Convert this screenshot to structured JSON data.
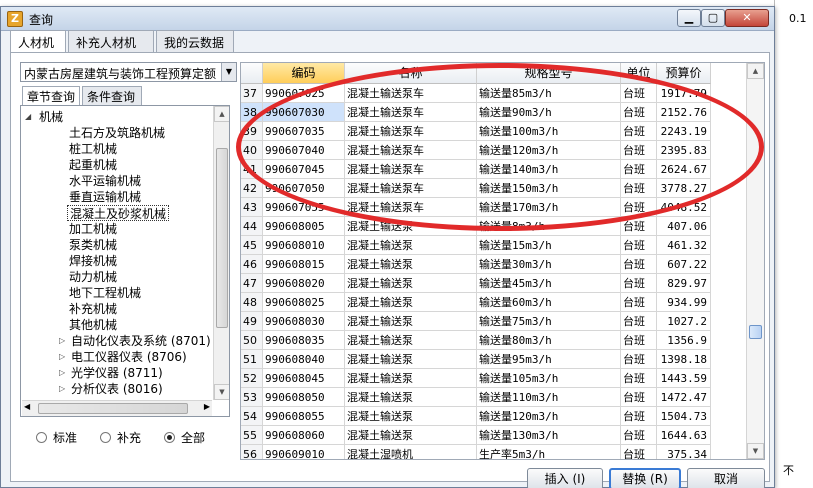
{
  "window": {
    "title": "查询",
    "app_icon": "app-logo-icon"
  },
  "background": {
    "right_value": "0.1",
    "bottom_right": "不"
  },
  "tabs": [
    {
      "label": "人材机",
      "active": true
    },
    {
      "label": "补充人材机",
      "active": false
    },
    {
      "label": "我的云数据",
      "active": false
    }
  ],
  "library_combo": {
    "value": "内蒙古房屋建筑与装饰工程预算定额"
  },
  "subtabs": [
    {
      "label": "章节查询",
      "active": true
    },
    {
      "label": "条件查询",
      "active": false
    }
  ],
  "tree": {
    "root": "机械",
    "children": [
      "土石方及筑路机械",
      "桩工机械",
      "起重机械",
      "水平运输机械",
      "垂直运输机械",
      "混凝土及砂浆机械",
      "加工机械",
      "泵类机械",
      "焊接机械",
      "动力机械",
      "地下工程机械",
      "补充机械",
      "其他机械"
    ],
    "selected": "混凝土及砂浆机械",
    "collapsed": [
      "自动化仪表及系统 (8701)",
      "电工仪器仪表 (8706)",
      "光学仪器 (8711)",
      "分析仪表 (8016)"
    ]
  },
  "filter": [
    {
      "label": "标准",
      "checked": false
    },
    {
      "label": "补充",
      "checked": false
    },
    {
      "label": "全部",
      "checked": true
    }
  ],
  "grid": {
    "columns": [
      {
        "key": "idx",
        "label": ""
      },
      {
        "key": "code",
        "label": "编码"
      },
      {
        "key": "name",
        "label": "名称"
      },
      {
        "key": "spec",
        "label": "规格型号"
      },
      {
        "key": "unit",
        "label": "单位"
      },
      {
        "key": "price",
        "label": "预算价"
      }
    ],
    "rows": [
      {
        "idx": "37",
        "code": "990607025",
        "name": "混凝土输送泵车",
        "spec": "输送量85m3/h",
        "unit": "台班",
        "price": "1917.79"
      },
      {
        "idx": "38",
        "code": "990607030",
        "name": "混凝土输送泵车",
        "spec": "输送量90m3/h",
        "unit": "台班",
        "price": "2152.76"
      },
      {
        "idx": "39",
        "code": "990607035",
        "name": "混凝土输送泵车",
        "spec": "输送量100m3/h",
        "unit": "台班",
        "price": "2243.19"
      },
      {
        "idx": "40",
        "code": "990607040",
        "name": "混凝土输送泵车",
        "spec": "输送量120m3/h",
        "unit": "台班",
        "price": "2395.83"
      },
      {
        "idx": "41",
        "code": "990607045",
        "name": "混凝土输送泵车",
        "spec": "输送量140m3/h",
        "unit": "台班",
        "price": "2624.67"
      },
      {
        "idx": "42",
        "code": "990607050",
        "name": "混凝土输送泵车",
        "spec": "输送量150m3/h",
        "unit": "台班",
        "price": "3778.27"
      },
      {
        "idx": "43",
        "code": "990607055",
        "name": "混凝土输送泵车",
        "spec": "输送量170m3/h",
        "unit": "台班",
        "price": "4048.52"
      },
      {
        "idx": "44",
        "code": "990608005",
        "name": "混凝土输送泵",
        "spec": "输送量8m3/h",
        "unit": "台班",
        "price": "407.06"
      },
      {
        "idx": "45",
        "code": "990608010",
        "name": "混凝土输送泵",
        "spec": "输送量15m3/h",
        "unit": "台班",
        "price": "461.32"
      },
      {
        "idx": "46",
        "code": "990608015",
        "name": "混凝土输送泵",
        "spec": "输送量30m3/h",
        "unit": "台班",
        "price": "607.22"
      },
      {
        "idx": "47",
        "code": "990608020",
        "name": "混凝土输送泵",
        "spec": "输送量45m3/h",
        "unit": "台班",
        "price": "829.97"
      },
      {
        "idx": "48",
        "code": "990608025",
        "name": "混凝土输送泵",
        "spec": "输送量60m3/h",
        "unit": "台班",
        "price": "934.99"
      },
      {
        "idx": "49",
        "code": "990608030",
        "name": "混凝土输送泵",
        "spec": "输送量75m3/h",
        "unit": "台班",
        "price": "1027.2"
      },
      {
        "idx": "50",
        "code": "990608035",
        "name": "混凝土输送泵",
        "spec": "输送量80m3/h",
        "unit": "台班",
        "price": "1356.9"
      },
      {
        "idx": "51",
        "code": "990608040",
        "name": "混凝土输送泵",
        "spec": "输送量95m3/h",
        "unit": "台班",
        "price": "1398.18"
      },
      {
        "idx": "52",
        "code": "990608045",
        "name": "混凝土输送泵",
        "spec": "输送量105m3/h",
        "unit": "台班",
        "price": "1443.59"
      },
      {
        "idx": "53",
        "code": "990608050",
        "name": "混凝土输送泵",
        "spec": "输送量110m3/h",
        "unit": "台班",
        "price": "1472.47"
      },
      {
        "idx": "54",
        "code": "990608055",
        "name": "混凝土输送泵",
        "spec": "输送量120m3/h",
        "unit": "台班",
        "price": "1504.73"
      },
      {
        "idx": "55",
        "code": "990608060",
        "name": "混凝土输送泵",
        "spec": "输送量130m3/h",
        "unit": "台班",
        "price": "1644.63"
      },
      {
        "idx": "56",
        "code": "990609010",
        "name": "混凝土湿喷机",
        "spec": "生产率5m3/h",
        "unit": "台班",
        "price": "375.34"
      }
    ],
    "selected_index": "38"
  },
  "buttons": {
    "insert": "插入 (I)",
    "replace": "替换 (R)",
    "cancel": "取消"
  },
  "colors": {
    "annotation_oval": "#e12a2a",
    "header_highlight": "#ffce5a",
    "selection": "#cfe2fb"
  }
}
